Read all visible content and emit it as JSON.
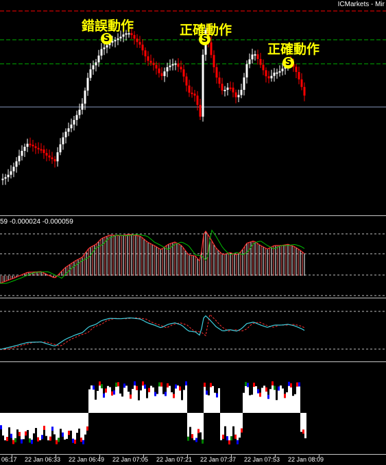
{
  "header": {
    "broker": "ICMarkets - Mir"
  },
  "annotations": [
    {
      "label": "錯誤動作",
      "signal": "S"
    },
    {
      "label": "正確動作",
      "signal": "S"
    },
    {
      "label": "正確動作",
      "signal": "S"
    }
  ],
  "macd_panel": {
    "label": "59 -0.000024 -0.000059"
  },
  "time_axis": {
    "labels": [
      "06:17",
      "22 Jan 06:33",
      "22 Jan 06:49",
      "22 Jan 07:05",
      "22 Jan 07:21",
      "22 Jan 07:37",
      "22 Jan 07:53",
      "22 Jan 08:09"
    ]
  },
  "colors": {
    "background": "#000000",
    "bull_candle": "#ffffff",
    "bear_candle": "#ff0000",
    "signal_badge": "#ffff00",
    "annotation_text": "#ffff00",
    "level_red": "#ff0000",
    "level_green": "#00b000",
    "current_price_line": "#8899bb"
  }
}
